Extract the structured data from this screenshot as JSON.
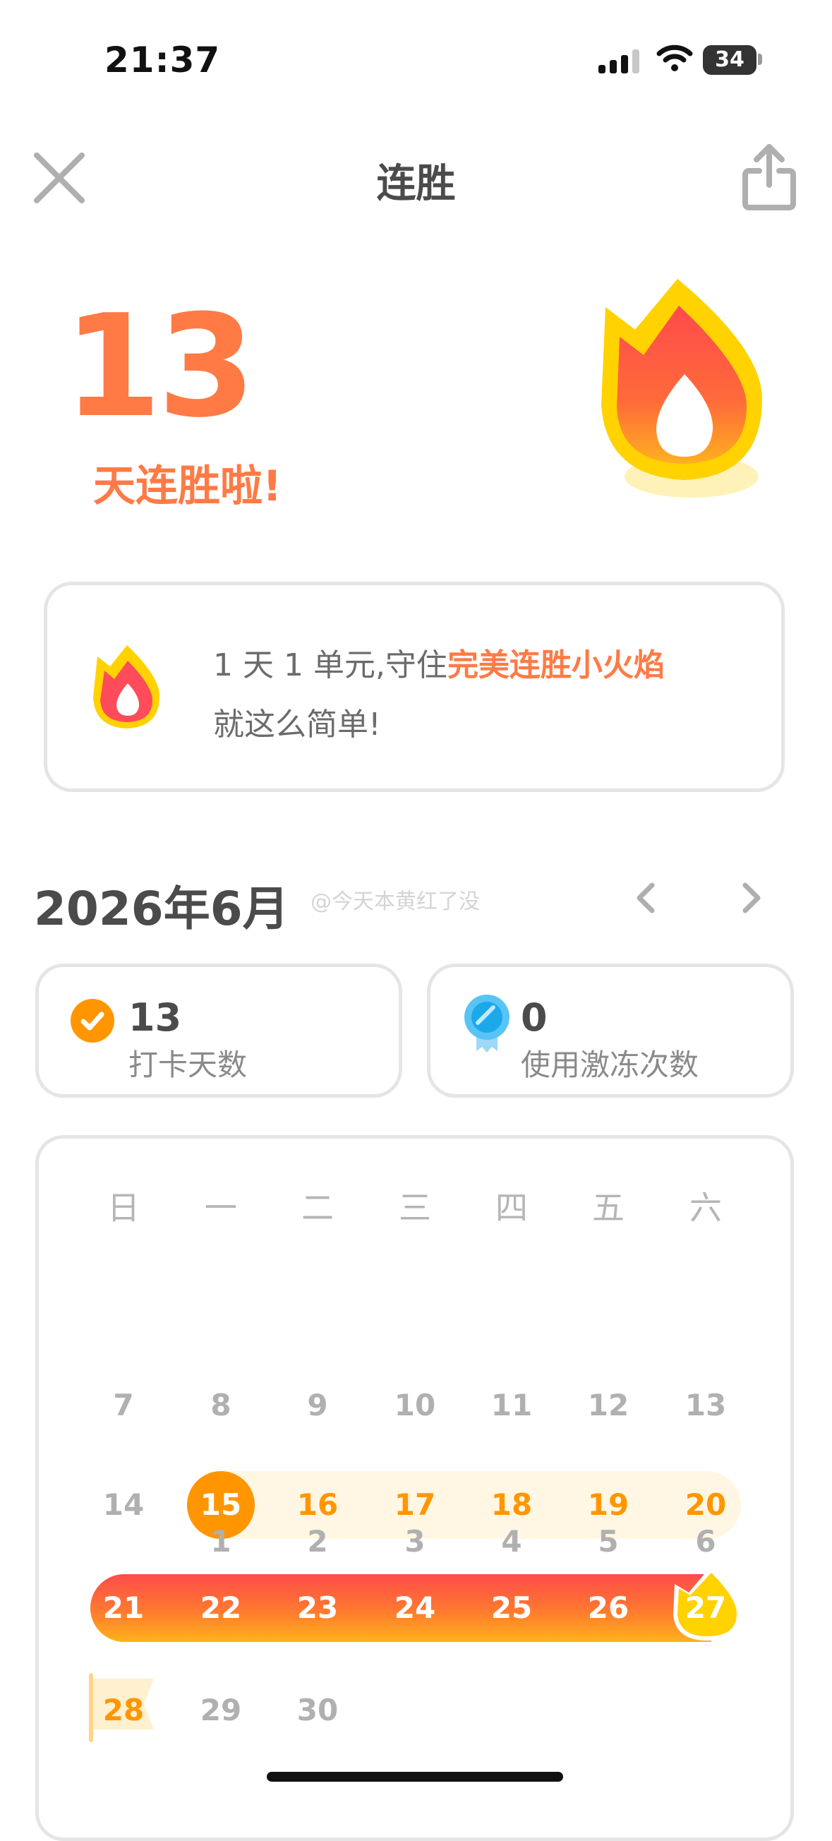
{
  "status_bar": {
    "time": "21:37",
    "battery": "34"
  },
  "header": {
    "title": "连胜"
  },
  "hero": {
    "streak_count": "13",
    "streak_label": "天连胜啦!"
  },
  "info": {
    "line1_prefix": "1 天 1 单元,守住",
    "line1_highlight": "完美连胜小火焰",
    "line2": "就这么简单!"
  },
  "calendar_header": {
    "month": "2026年6月",
    "watermark": "@今天本黄红了没"
  },
  "stats": {
    "checkin_value": "13",
    "checkin_label": "打卡天数",
    "freeze_value": "0",
    "freeze_label": "使用激冻次数"
  },
  "calendar": {
    "weekdays": [
      "日",
      "一",
      "二",
      "三",
      "四",
      "五",
      "六"
    ],
    "days": [
      "1",
      "2",
      "3",
      "4",
      "5",
      "6",
      "7",
      "8",
      "9",
      "10",
      "11",
      "12",
      "13",
      "14",
      "15",
      "16",
      "17",
      "18",
      "19",
      "20",
      "21",
      "22",
      "23",
      "24",
      "25",
      "26",
      "27",
      "28",
      "29",
      "30"
    ]
  },
  "colors": {
    "accent_orange": "#ff7a45",
    "streak_gold": "#ff9600",
    "streak_red": "#ff4b4b",
    "freeze_blue": "#58c4f5"
  }
}
